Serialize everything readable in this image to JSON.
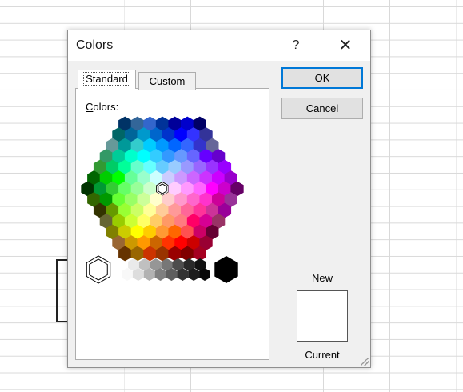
{
  "dialog": {
    "title": "Colors",
    "help_glyph": "?",
    "close_glyph": "✕",
    "tabs": [
      {
        "label": "Standard",
        "active": true
      },
      {
        "label": "Custom",
        "active": false
      }
    ],
    "colors_label_mnemonic": "C",
    "colors_label_rest": "olors:",
    "ok_label": "OK",
    "cancel_label": "Cancel",
    "new_label": "New",
    "current_label": "Current",
    "new_color": "#ffffff",
    "current_color": "#ffffff",
    "selected_color": "#ffffff"
  },
  "palette": {
    "rows": [
      [
        "#003366",
        "#336699",
        "#3366cc",
        "#003399",
        "#000099",
        "#0000cc",
        "#000066"
      ],
      [
        "#006666",
        "#006699",
        "#0099cc",
        "#0066cc",
        "#0033cc",
        "#0000ff",
        "#3333ff",
        "#333399"
      ],
      [
        "#669999",
        "#009999",
        "#33cccc",
        "#00ccff",
        "#0099ff",
        "#0066ff",
        "#3366ff",
        "#3333cc",
        "#666699"
      ],
      [
        "#339966",
        "#00cc99",
        "#00ffcc",
        "#00ffff",
        "#33ccff",
        "#3399ff",
        "#6699ff",
        "#6666ff",
        "#6600ff",
        "#6600cc"
      ],
      [
        "#339933",
        "#00cc66",
        "#00ff99",
        "#66ffcc",
        "#66ffff",
        "#66ccff",
        "#99ccff",
        "#9999ff",
        "#9966ff",
        "#9933ff",
        "#9900ff"
      ],
      [
        "#006600",
        "#00cc00",
        "#00ff00",
        "#66ff99",
        "#99ffcc",
        "#ccffff",
        "#ccccff",
        "#cc99ff",
        "#cc66ff",
        "#cc33ff",
        "#cc00ff",
        "#9900cc"
      ],
      [
        "#003300",
        "#009933",
        "#33cc33",
        "#66ff66",
        "#99ff99",
        "#ccffcc",
        "#ffffff",
        "#ffccff",
        "#ff99ff",
        "#ff66ff",
        "#ff00ff",
        "#cc00cc",
        "#660066"
      ],
      [
        "#336600",
        "#009900",
        "#66ff33",
        "#99ff66",
        "#ccff99",
        "#ffffcc",
        "#ffcccc",
        "#ff99cc",
        "#ff66cc",
        "#ff33cc",
        "#cc0099",
        "#993399"
      ],
      [
        "#333300",
        "#669900",
        "#99ff33",
        "#ccff66",
        "#ffff99",
        "#ffcc99",
        "#ff9999",
        "#ff6699",
        "#ff3399",
        "#cc3399",
        "#990099"
      ],
      [
        "#666633",
        "#99cc00",
        "#ccff33",
        "#ffff66",
        "#ffcc66",
        "#ff9966",
        "#ff7c80",
        "#ff0066",
        "#d60093",
        "#993366"
      ],
      [
        "#808000",
        "#cccc00",
        "#ffff00",
        "#ffcc00",
        "#ff9933",
        "#ff6600",
        "#ff5050",
        "#cc0066",
        "#660033"
      ],
      [
        "#996633",
        "#cc9900",
        "#ff9900",
        "#cc6600",
        "#ff3300",
        "#ff0000",
        "#cc0000",
        "#990033"
      ],
      [
        "#663300",
        "#996600",
        "#cc3300",
        "#993300",
        "#990000",
        "#800000",
        "#a50021"
      ]
    ],
    "grays": [
      "#f8f8f8",
      "#dddddd",
      "#b2b2b2",
      "#808080",
      "#5f5f5f",
      "#333333",
      "#1c1c1c",
      "#080808"
    ],
    "grays_top": [
      "#eaeaea",
      "#c0c0c0",
      "#969696",
      "#777777",
      "#4d4d4d",
      "#292929",
      "#111111"
    ],
    "white": "#ffffff",
    "black": "#000000"
  }
}
